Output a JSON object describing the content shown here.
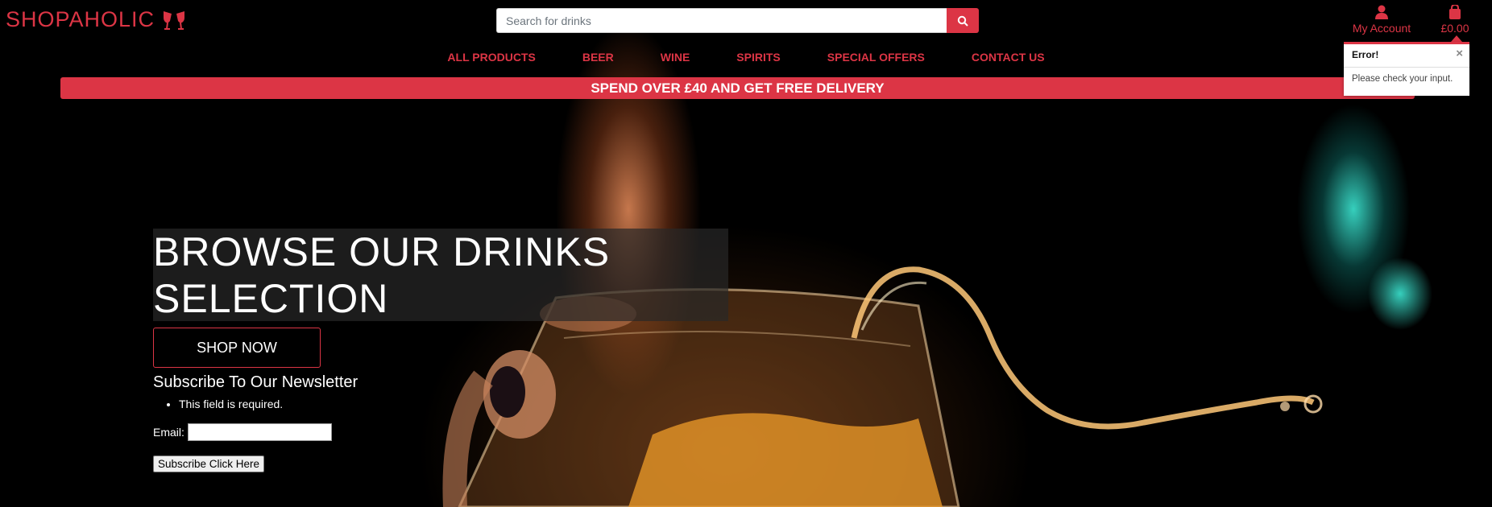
{
  "header": {
    "logo_text": "SHOPAHOLIC",
    "search_placeholder": "Search for drinks",
    "account_label": "My Account",
    "cart_total": "£0.00"
  },
  "nav": {
    "items": [
      "ALL PRODUCTS",
      "BEER",
      "WINE",
      "SPIRITS",
      "SPECIAL OFFERS",
      "CONTACT US"
    ]
  },
  "banner": {
    "text": "SPEND OVER £40 AND GET FREE DELIVERY"
  },
  "toast": {
    "title": "Error!",
    "close": "×",
    "message": "Please check your input."
  },
  "hero": {
    "title_line1": "BROWSE OUR DRINKS",
    "title_line2": "SELECTION",
    "shop_button": "SHOP NOW"
  },
  "newsletter": {
    "title": "Subscribe To Our Newsletter",
    "error": "This field is required.",
    "email_label": "Email:",
    "email_value": "",
    "submit_label": "Subscribe Click Here"
  },
  "colors": {
    "accent": "#dc3545",
    "background": "#000000"
  }
}
